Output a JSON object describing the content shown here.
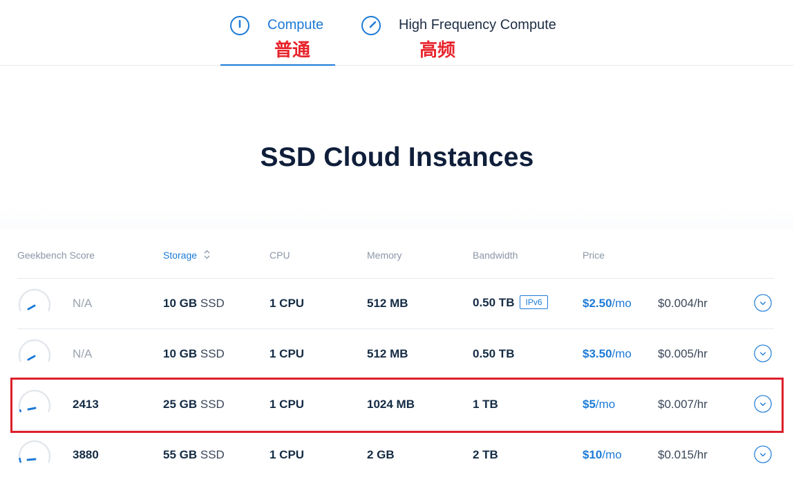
{
  "tabs": [
    {
      "label": "Compute",
      "annotation": "普通",
      "active": true
    },
    {
      "label": "High Frequency Compute",
      "annotation": "高频",
      "active": false
    }
  ],
  "title": "SSD Cloud Instances",
  "columns": {
    "geekbench": "Geekbench Score",
    "storage": "Storage",
    "cpu": "CPU",
    "memory": "Memory",
    "bandwidth": "Bandwidth",
    "price": "Price"
  },
  "rows": [
    {
      "score": "N/A",
      "storage_num": "10 GB",
      "storage_unit": "SSD",
      "cpu": "1 CPU",
      "memory": "512 MB",
      "bandwidth": "0.50 TB",
      "badge": "IPv6",
      "price_num": "$2.50",
      "price_unit": "/mo",
      "hourly": "$0.004/hr"
    },
    {
      "score": "N/A",
      "storage_num": "10 GB",
      "storage_unit": "SSD",
      "cpu": "1 CPU",
      "memory": "512 MB",
      "bandwidth": "0.50 TB",
      "badge": "",
      "price_num": "$3.50",
      "price_unit": "/mo",
      "hourly": "$0.005/hr"
    },
    {
      "score": "2413",
      "storage_num": "25 GB",
      "storage_unit": "SSD",
      "cpu": "1 CPU",
      "memory": "1024 MB",
      "bandwidth": "1 TB",
      "badge": "",
      "price_num": "$5",
      "price_unit": "/mo",
      "hourly": "$0.007/hr"
    },
    {
      "score": "3880",
      "storage_num": "55 GB",
      "storage_unit": "SSD",
      "cpu": "1 CPU",
      "memory": "2 GB",
      "bandwidth": "2 TB",
      "badge": "",
      "price_num": "$10",
      "price_unit": "/mo",
      "hourly": "$0.015/hr"
    }
  ],
  "colors": {
    "accent": "#1b7ad6",
    "highlight": "#dc1f2a",
    "title": "#0f1e3a"
  },
  "icons": {
    "compute": "gauge-low-icon",
    "high_frequency": "gauge-high-icon",
    "sort": "sort-arrows-icon",
    "expand": "chevron-down-circle-icon"
  }
}
